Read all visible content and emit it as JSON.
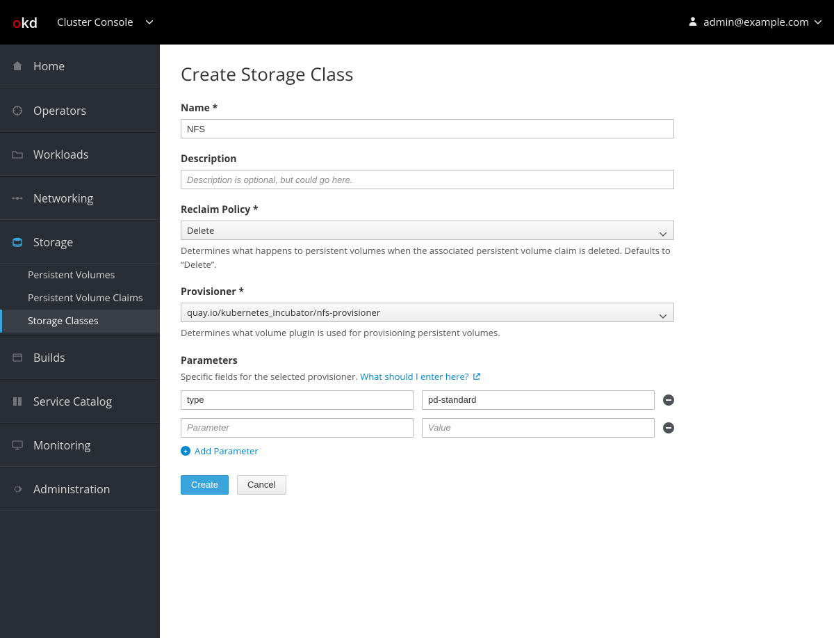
{
  "brand": {
    "o": "o",
    "k": "k",
    "d": "d"
  },
  "header": {
    "console_label": "Cluster Console",
    "user": "admin@example.com"
  },
  "sidebar": {
    "items": [
      {
        "label": "Home"
      },
      {
        "label": "Operators"
      },
      {
        "label": "Workloads"
      },
      {
        "label": "Networking"
      },
      {
        "label": "Storage"
      },
      {
        "label": "Builds"
      },
      {
        "label": "Service Catalog"
      },
      {
        "label": "Monitoring"
      },
      {
        "label": "Administration"
      }
    ],
    "storage_sub": [
      {
        "label": "Persistent Volumes"
      },
      {
        "label": "Persistent Volume Claims"
      },
      {
        "label": "Storage Classes"
      }
    ]
  },
  "page": {
    "title": "Create Storage Class",
    "name_label": "Name *",
    "name_value": "NFS",
    "desc_label": "Description",
    "desc_placeholder": "Description is optional, but could go here.",
    "reclaim_label": "Reclaim Policy *",
    "reclaim_value": "Delete",
    "reclaim_help": "Determines what happens to persistent volumes when the associated persistent volume claim is deleted. Defaults to “Delete”.",
    "prov_label": "Provisioner *",
    "prov_value": "quay.io/kubernetes_incubator/nfs-provisioner",
    "prov_help": "Determines what volume plugin is used for provisioning persistent volumes.",
    "params_label": "Parameters",
    "params_desc_prefix": "Specific fields for the selected provisioner.  ",
    "params_link": "What should I enter here?",
    "param_rows": [
      {
        "key": "type",
        "value": "pd-standard"
      },
      {
        "key": "",
        "value": ""
      }
    ],
    "param_key_placeholder": "Parameter",
    "param_value_placeholder": "Value",
    "add_param": "Add Parameter",
    "create": "Create",
    "cancel": "Cancel"
  }
}
